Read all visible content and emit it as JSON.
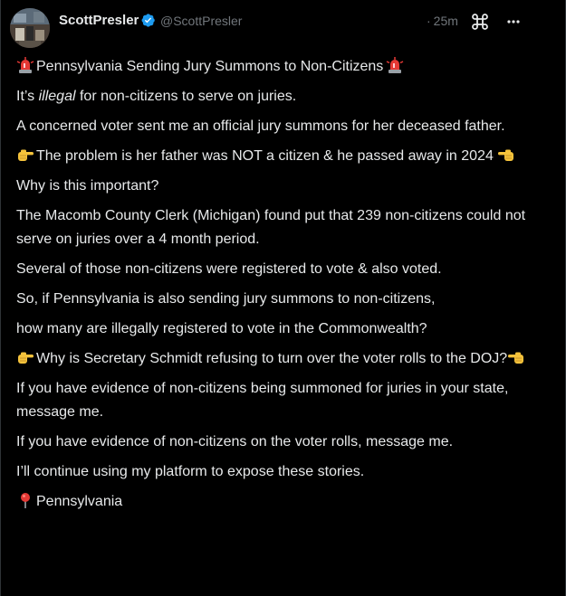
{
  "author": {
    "display_name": "ScottPresler",
    "handle": "@ScottPresler",
    "verified": true,
    "avatar": "avatar-photo"
  },
  "meta": {
    "dot": "·",
    "timestamp": "25m"
  },
  "icons": {
    "verified": "verified-badge-icon",
    "grok": "grok-icon",
    "more": "more-options-icon",
    "siren": "police-car-light-emoji",
    "point_right": "backhand-index-pointing-right-emoji",
    "point_left": "backhand-index-pointing-left-emoji",
    "pin": "round-pushpin-emoji"
  },
  "colors": {
    "background": "#000000",
    "text": "#e7e9ea",
    "muted": "#71767b",
    "verified_blue": "#1d9bf0",
    "border": "#2f3336"
  },
  "post": {
    "title": "Pennsylvania Sending Jury Summons to Non-Citizens",
    "line1_pre": "It’s ",
    "line1_em": "illegal",
    "line1_post": " for non-citizens to serve on juries.",
    "line2": "A concerned voter sent me an official jury summons for her deceased father.",
    "line3": "The problem is her father was NOT a citizen & he passed away in 2024",
    "line4": "Why is this important?",
    "line5": "The Macomb County Clerk (Michigan) found put that 239 non-citizens could not serve on juries over a 4 month period.",
    "line6": "Several of those non-citizens were registered to vote & also voted.",
    "line7": "So, if Pennsylvania is also sending jury summons to non-citizens,",
    "line8": "how many are illegally registered to vote in the Commonwealth?",
    "line9": "Why is Secretary Schmidt refusing to turn over the voter rolls to the DOJ?",
    "line10": "If you have evidence of non-citizens being summoned for juries in your state, message me.",
    "line11": "If you have evidence of non-citizens on the voter rolls, message me.",
    "line12": "I’ll continue using my platform to expose these stories.",
    "location": "Pennsylvania"
  }
}
